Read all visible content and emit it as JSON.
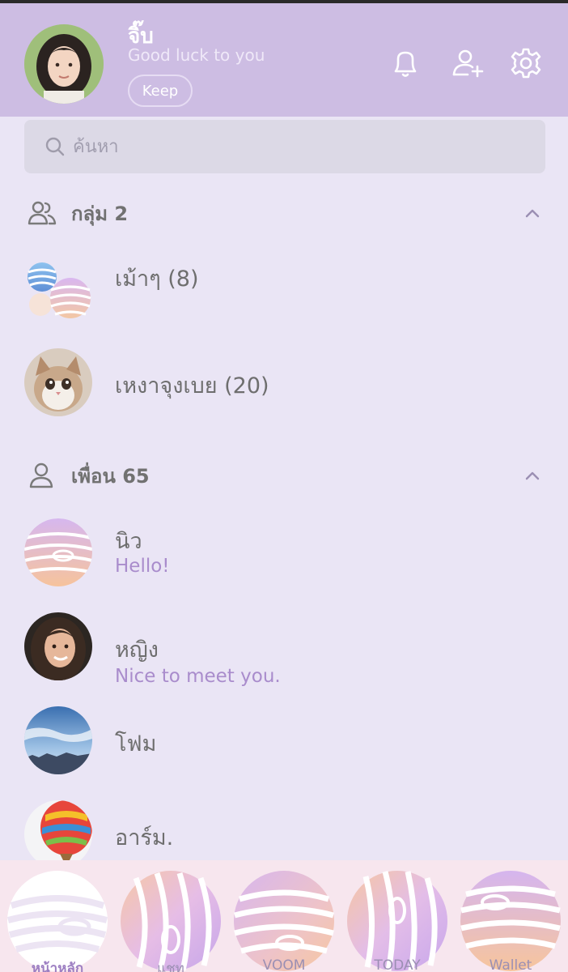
{
  "profile": {
    "name": "จิ๊บ",
    "status": "Good luck to you",
    "keep_label": "Keep"
  },
  "search": {
    "placeholder": "ค้นหา"
  },
  "groups": {
    "header": "กลุ่ม 2",
    "items": [
      {
        "name": "เม้าๆ (8)"
      },
      {
        "name": "เหงาจุงเบย (20)"
      }
    ]
  },
  "friends": {
    "header": "เพื่อน 65",
    "items": [
      {
        "name": "นิว",
        "status": "Hello!"
      },
      {
        "name": "หญิง",
        "status": "Nice to meet you."
      },
      {
        "name": "โฟม",
        "status": ""
      },
      {
        "name": "อาร์ม.",
        "status": ""
      }
    ]
  },
  "tabs": [
    {
      "label": "หน้าหลัก",
      "icon": "home-icon",
      "active": true
    },
    {
      "label": "แชท",
      "icon": "chat-icon",
      "active": false
    },
    {
      "label": "VOOM",
      "icon": "voom-icon",
      "active": false
    },
    {
      "label": "TODAY",
      "icon": "today-icon",
      "active": false
    },
    {
      "label": "Wallet",
      "icon": "wallet-icon",
      "active": false
    }
  ],
  "colors": {
    "header_bg": "#cdbde3",
    "page_bg": "#eae5f5",
    "status_text": "#a98ccc",
    "tabbar_bg": "#f7e6ee"
  }
}
